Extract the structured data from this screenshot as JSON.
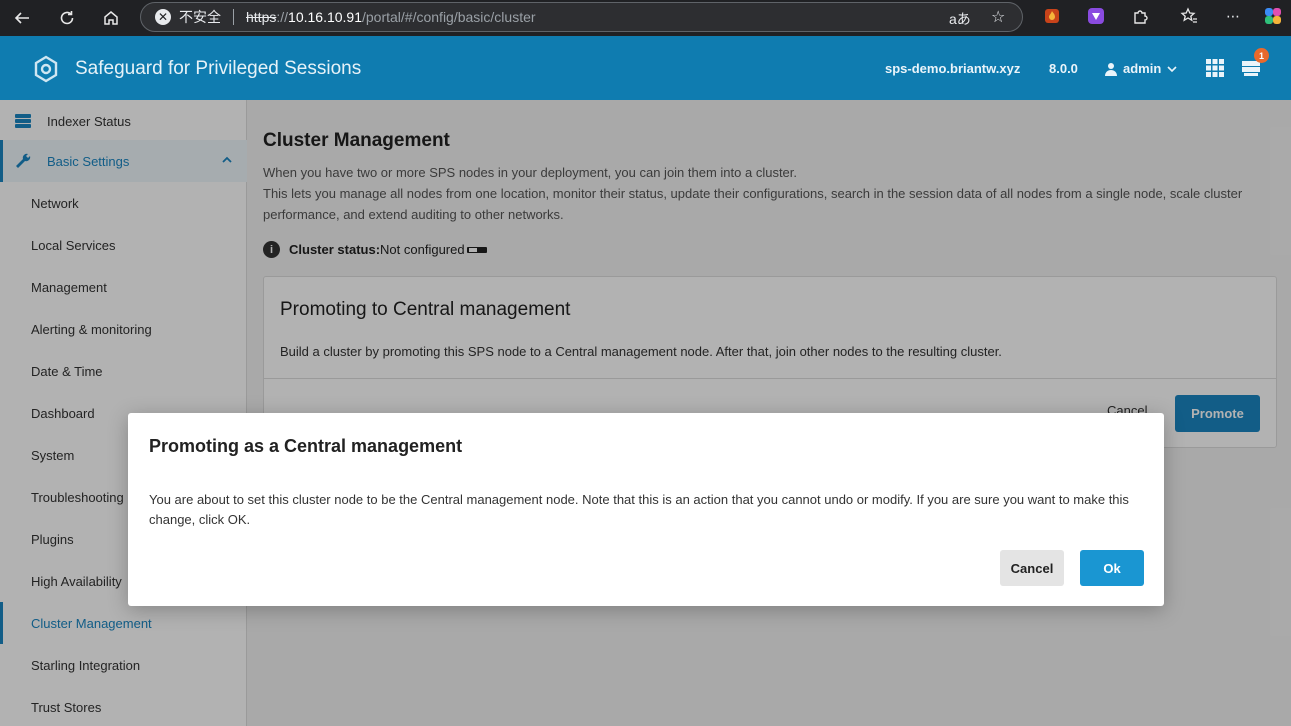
{
  "browser": {
    "insecure_label": "不安全",
    "url_scheme": "https",
    "url_sep": "://",
    "url_host": "10.16.10.91",
    "url_path": "/portal/#/config/basic/cluster",
    "read_aloud_icon": "aあ"
  },
  "header": {
    "app_title": "Safeguard for Privileged Sessions",
    "hostname": "sps-demo.briantw.xyz",
    "version": "8.0.0",
    "user": "admin",
    "notification_count": "1"
  },
  "sidebar": {
    "items": [
      {
        "label": "Indexer Status"
      },
      {
        "label": "Basic Settings"
      },
      {
        "label": "Network"
      },
      {
        "label": "Local Services"
      },
      {
        "label": "Management"
      },
      {
        "label": "Alerting & monitoring"
      },
      {
        "label": "Date & Time"
      },
      {
        "label": "Dashboard"
      },
      {
        "label": "System"
      },
      {
        "label": "Troubleshooting"
      },
      {
        "label": "Plugins"
      },
      {
        "label": "High Availability"
      },
      {
        "label": "Cluster Management"
      },
      {
        "label": "Starling Integration"
      },
      {
        "label": "Trust Stores"
      }
    ]
  },
  "main": {
    "title": "Cluster Management",
    "desc_line1": "When you have two or more SPS nodes in your deployment, you can join them into a cluster.",
    "desc_line2": "This lets you manage all nodes from one location, monitor their status, update their configurations, search in the session data of all nodes from a single node, scale cluster performance, and extend auditing to other networks.",
    "status_label": "Cluster status:",
    "status_value": "Not configured",
    "panel": {
      "title": "Promoting to Central management",
      "text": "Build a cluster by promoting this SPS node to a Central management node. After that, join other nodes to the resulting cluster.",
      "cancel_label": "Cancel",
      "promote_label": "Promote"
    }
  },
  "modal": {
    "title": "Promoting as a Central management",
    "body": "You are about to set this cluster node to be the Central management node. Note that this is an action that you cannot undo or modify. If you are sure you want to make this change, click OK.",
    "cancel_label": "Cancel",
    "ok_label": "Ok"
  },
  "colors": {
    "header_bg": "#0f7cb0",
    "accent": "#1a86c2",
    "ok_button": "#1a96d2",
    "badge": "#e8692c"
  }
}
